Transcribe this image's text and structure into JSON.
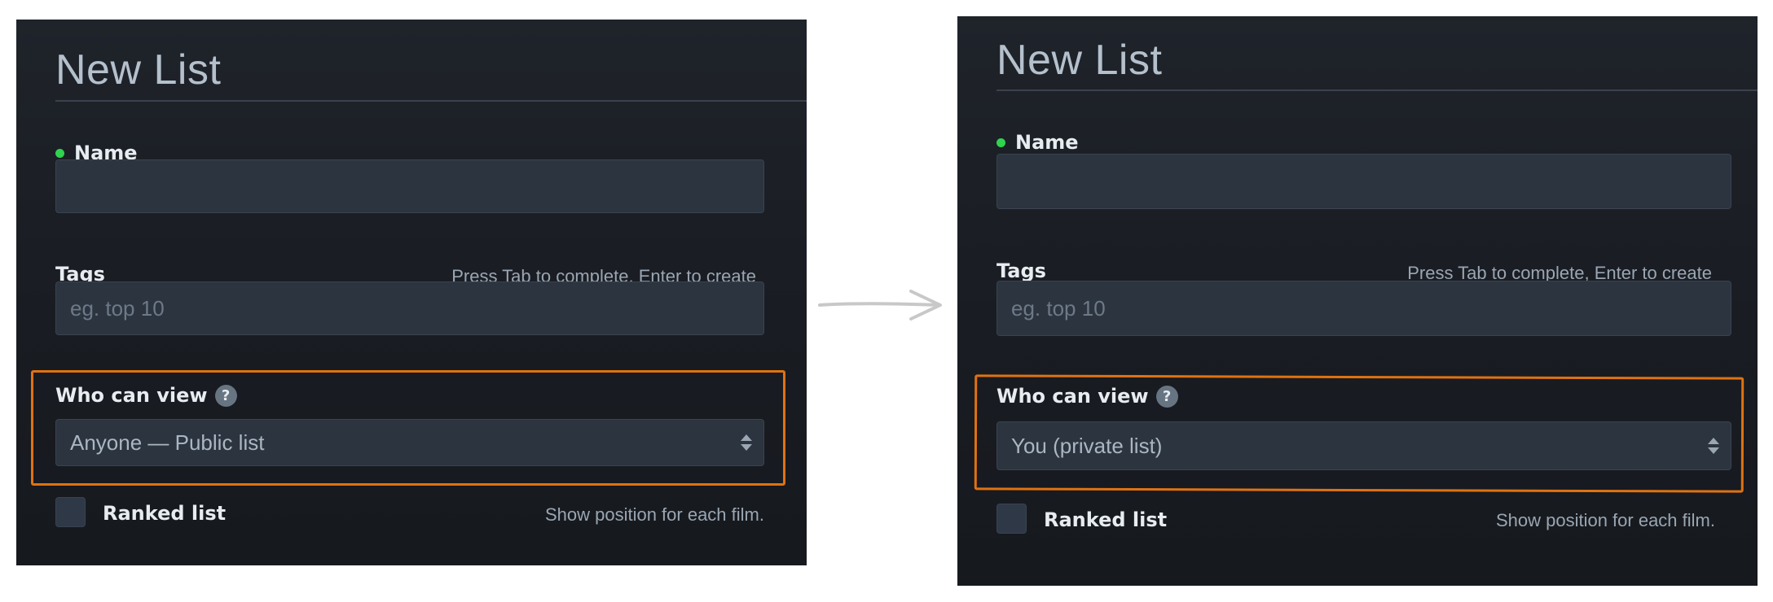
{
  "before": {
    "title": "New List",
    "name_label": "Name",
    "name_value": "",
    "tags_label": "Tags",
    "tags_hint": "Press Tab to complete, Enter to create",
    "tags_placeholder": "eg. top 10",
    "who_label": "Who can view",
    "help_glyph": "?",
    "visibility_value": "Anyone — Public list",
    "ranked_label": "Ranked list",
    "ranked_hint": "Show position for each film.",
    "ranked_checked": false
  },
  "after": {
    "title": "New List",
    "name_label": "Name",
    "name_value": "",
    "tags_label": "Tags",
    "tags_hint": "Press Tab to complete, Enter to create",
    "tags_placeholder": "eg. top 10",
    "who_label": "Who can view",
    "help_glyph": "?",
    "visibility_value": "You (private list)",
    "ranked_label": "Ranked list",
    "ranked_hint": "Show position for each film.",
    "ranked_checked": false
  },
  "colors": {
    "panel_bg": "#1d2026",
    "field_bg": "#2c3440",
    "required_dot": "#2fd44e",
    "highlight": "#e07211",
    "transition_arrow": "#c8c8c8"
  },
  "icons": [
    "required-dot-icon",
    "help-icon",
    "select-arrows-icon",
    "transition-arrow-icon"
  ]
}
